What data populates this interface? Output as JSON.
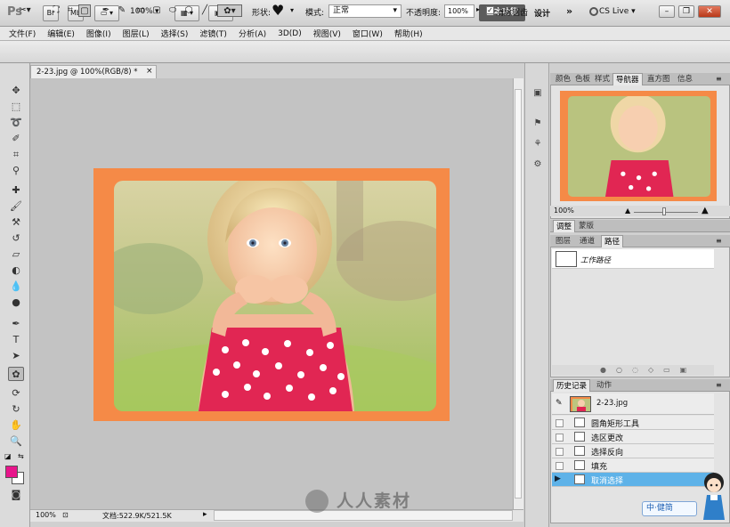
{
  "appbar": {
    "logo": "Ps",
    "btn_br": "Br",
    "btn_mb": "Mb",
    "zoom": "100%",
    "workspace_active": "基本功能",
    "workspace_design": "设计",
    "more": "»",
    "cs_live": "CS Live"
  },
  "menu": [
    "文件(F)",
    "编辑(E)",
    "图像(I)",
    "图层(L)",
    "选择(S)",
    "滤镜(T)",
    "分析(A)",
    "3D(D)",
    "视图(V)",
    "窗口(W)",
    "帮助(H)"
  ],
  "options": {
    "shape_label": "形状:",
    "shape_glyph": "♥",
    "mode_label": "模式:",
    "mode_value": "正常",
    "opacity_label": "不透明度:",
    "opacity_value": "100%",
    "antialias_check": "✓",
    "antialias_label": "消除锯齿"
  },
  "document": {
    "tab_title": "2-23.jpg @ 100%(RGB/8) *",
    "tab_close": "×",
    "zoom_status": "100%",
    "doc_status": "文档:522.9K/521.5K"
  },
  "panels": {
    "top_tabs": [
      "颜色",
      "色板",
      "样式",
      "导航器",
      "直方图",
      "信息"
    ],
    "nav_zoom": "100%",
    "adjust_tabs": [
      "调整",
      "蒙版"
    ],
    "layer_tabs": [
      "图层",
      "通道",
      "路径"
    ],
    "path_name": "工作路径",
    "history_tabs": [
      "历史记录",
      "动作"
    ],
    "history_snapshot": "2-23.jpg",
    "history_items": [
      "圆角矩形工具",
      "选区更改",
      "选择反向",
      "填充",
      "取消选择"
    ]
  },
  "watermark": "人人素材",
  "ime": "中·健简",
  "colors": {
    "frame": "#f58a47",
    "history_selected": "#5eb2e8",
    "foreground": "#e8168c"
  }
}
